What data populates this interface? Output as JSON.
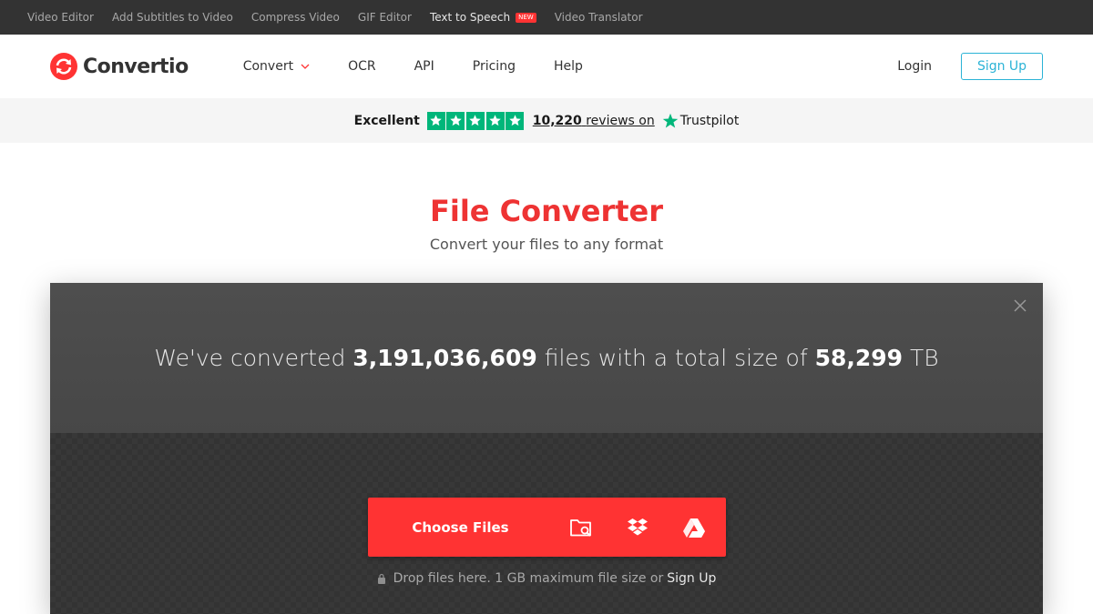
{
  "topbar": {
    "links": [
      "Video Editor",
      "Add Subtitles to Video",
      "Compress Video",
      "GIF Editor",
      "Text to Speech",
      "Video Translator"
    ],
    "new_badge": "NEW"
  },
  "header": {
    "logo_text": "Convertio",
    "nav": [
      "Convert",
      "OCR",
      "API",
      "Pricing",
      "Help"
    ],
    "login": "Login",
    "signup": "Sign Up"
  },
  "trust": {
    "rating_word": "Excellent",
    "review_count": "10,220",
    "reviews_on": "reviews on",
    "provider": "Trustpilot",
    "stars": 5
  },
  "hero": {
    "title": "File Converter",
    "subtitle": "Convert your files to any format"
  },
  "stats": {
    "prefix": "We've converted",
    "files_count": "3,191,036,609",
    "middle": "files with a total size of",
    "size": "58,299",
    "unit": "TB"
  },
  "upload": {
    "choose_label": "Choose Files",
    "drop_text": "Drop files here. 1 GB maximum file size or",
    "signup_link": "Sign Up"
  },
  "colors": {
    "brand_red": "#ff3333",
    "accent_blue": "#2bb3d6",
    "trustpilot_green": "#00b67a"
  }
}
